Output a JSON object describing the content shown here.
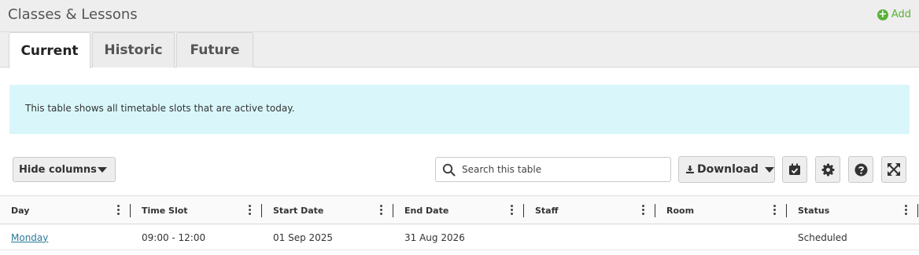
{
  "header": {
    "title": "Classes & Lessons",
    "add_label": "Add"
  },
  "tabs": [
    {
      "label": "Current",
      "active": true
    },
    {
      "label": "Historic",
      "active": false
    },
    {
      "label": "Future",
      "active": false
    }
  ],
  "info": {
    "text": "This table shows all timetable slots that are active today."
  },
  "toolbar": {
    "hide_columns_label": "Hide columns",
    "search_placeholder": "Search this table",
    "download_label": "Download"
  },
  "icons": {
    "calendar": "calendar-check-icon",
    "settings": "gear-icon",
    "help": "question-circle-icon",
    "expand": "expand-icon",
    "download": "download-icon",
    "search": "search-icon",
    "add": "plus-circle-icon"
  },
  "colors": {
    "accent_green": "#5ab13a",
    "info_bg": "#d9f7fb",
    "link": "#2b7a9a"
  },
  "table": {
    "columns": [
      "Day",
      "Time Slot",
      "Start Date",
      "End Date",
      "Staff",
      "Room",
      "Status"
    ],
    "rows": [
      {
        "day": "Monday",
        "time_slot": "09:00 - 12:00",
        "start_date": "01 Sep 2025",
        "end_date": "31 Aug 2026",
        "staff": "",
        "room": "",
        "status": "Scheduled"
      }
    ]
  }
}
